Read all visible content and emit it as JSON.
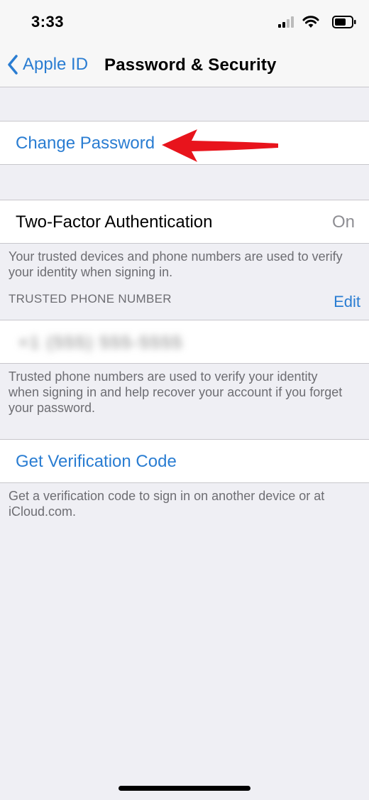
{
  "status_bar": {
    "time": "3:33"
  },
  "nav": {
    "back_label": "Apple ID",
    "title": "Password & Security"
  },
  "change_password": {
    "label": "Change Password"
  },
  "two_factor": {
    "label": "Two-Factor Authentication",
    "value": "On",
    "footer": "Your trusted devices and phone numbers are used to verify your identity when signing in."
  },
  "trusted_phone": {
    "header": "TRUSTED PHONE NUMBER",
    "edit_label": "Edit",
    "number": "+1 (555) 555-5555",
    "footer": "Trusted phone numbers are used to verify your identity when signing in and help recover your account if you forget your password."
  },
  "verification_code": {
    "label": "Get Verification Code",
    "footer": "Get a verification code to sign in on another device or at iCloud.com."
  },
  "colors": {
    "accent": "#2A7DD2",
    "annotation": "#E8141C",
    "background": "#EFEFF4"
  }
}
